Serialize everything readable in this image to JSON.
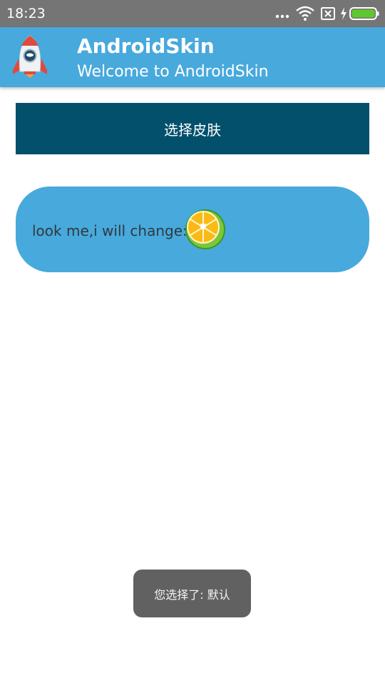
{
  "status_bar": {
    "time": "18:23",
    "icons": [
      "more-dots-icon",
      "wifi-icon",
      "no-sim-icon",
      "charging-bolt-icon",
      "battery-icon"
    ],
    "battery_color": "#5ec82e"
  },
  "app_bar": {
    "title": "AndroidSkin",
    "subtitle": "Welcome to AndroidSkin",
    "logo_icon": "rocket-icon",
    "color": "#48a9dc"
  },
  "skin_button": {
    "label": "选择皮肤",
    "color": "#02506c"
  },
  "change_card": {
    "label": "look me,i will change:",
    "icon": "lemon-slice-icon",
    "color": "#48a9dc"
  },
  "toast": {
    "message": "您选择了: 默认"
  }
}
